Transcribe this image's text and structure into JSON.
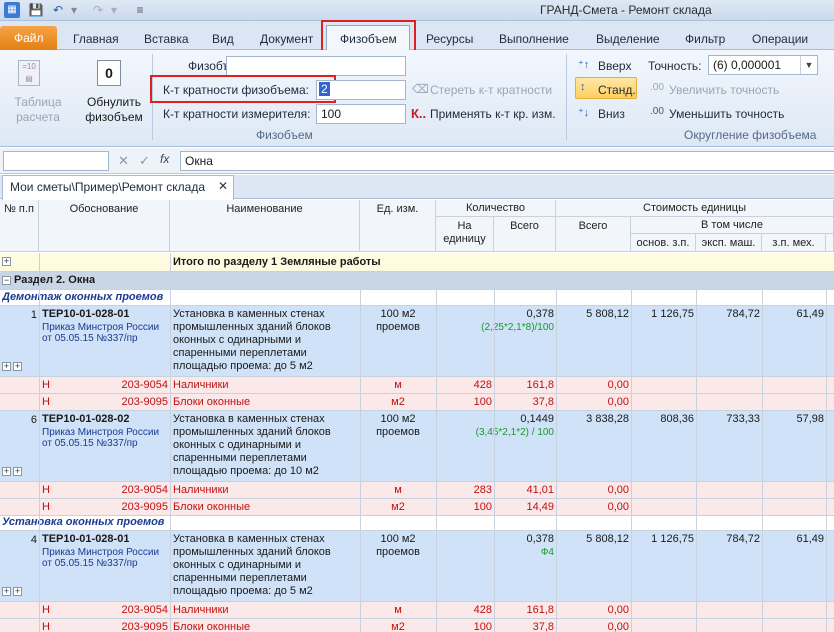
{
  "window": {
    "title": "ГРАНД-Смета - Ремонт склада"
  },
  "ribbon_tabs": [
    "Файл",
    "Главная",
    "Вставка",
    "Вид",
    "Документ",
    "Физобъем",
    "Ресурсы",
    "Выполнение",
    "Выделение",
    "Фильтр",
    "Операции"
  ],
  "ribbon": {
    "table_btn": "Таблица расчета",
    "reset_btn": "Обнулить физобъем",
    "fiz_label": "Физобъем:",
    "fiz_value": "",
    "k_label": "К-т кратности  физобъема:",
    "k_value": "2",
    "km_label": "К-т кратности измерителя:",
    "km_value": "100",
    "clear_k": "Стереть к-т кратности",
    "apply_k": "Применять к-т кр. изм.",
    "apply_k_icon": "К..",
    "group_fiz": "Физобъем",
    "up": "Вверх",
    "std": "Станд.",
    "down": "Вниз",
    "precision_label": "Точность:",
    "precision_value": "(6) 0,000001",
    "inc_prec": "Увеличить точность",
    "dec_prec": "Уменьшить точность",
    "group_round": "Округление физобъема"
  },
  "formula": {
    "value": "Окна"
  },
  "doc_tab": "Мои сметы\\Пример\\Ремонт склада",
  "columns": {
    "n": "№ п.п",
    "basis": "Обоснование",
    "name": "Наименование",
    "unit": "Ед. изм.",
    "qty": "Количество",
    "per_unit": "На единицу",
    "total": "Всего",
    "cost": "Стоимость единицы",
    "cost_total": "Всего",
    "incl": "В том числе",
    "osn": "основ. з.п.",
    "eksp": "эксп. маш.",
    "zpmeh": "з.п. мех."
  },
  "rows": {
    "total1": "Итого по разделу 1 Земляные работы",
    "section2": "Раздел 2. Окна",
    "sub1": "Демонтаж оконных проемов",
    "sub2": "Установка оконных проемов"
  },
  "items": [
    {
      "n": "1",
      "code": "ТЕР10-01-028-01",
      "ref": "Приказ Минстроя России от 05.05.15 №337/пр",
      "name": "Установка в каменных стенах промышленных зданий блоков оконных с одинарными и спаренными переплетами площадью проема: до 5 м2",
      "unit": "100 м2 проемов",
      "qty": "0,378",
      "formula": "(2,25*2,1*8)/100",
      "cost": "5 808,12",
      "osn": "1 126,75",
      "eksp": "784,72",
      "zpmeh": "61,49",
      "res": [
        {
          "t": "Н",
          "code": "203-9054",
          "name": "Наличники",
          "unit": "м",
          "per": "428",
          "total": "161,8",
          "cost": "0,00"
        },
        {
          "t": "Н",
          "code": "203-9095",
          "name": "Блоки оконные",
          "unit": "м2",
          "per": "100",
          "total": "37,8",
          "cost": "0,00"
        }
      ]
    },
    {
      "n": "6",
      "code": "ТЕР10-01-028-02",
      "ref": "Приказ Минстроя России от 05.05.15 №337/пр",
      "name": "Установка в каменных стенах промышленных зданий блоков оконных с одинарными и спаренными переплетами площадью проема: до 10 м2",
      "unit": "100 м2 проемов",
      "qty": "0,1449",
      "formula": "(3,45*2,1*2) / 100",
      "cost": "3 838,28",
      "osn": "808,36",
      "eksp": "733,33",
      "zpmeh": "57,98",
      "res": [
        {
          "t": "Н",
          "code": "203-9054",
          "name": "Наличники",
          "unit": "м",
          "per": "283",
          "total": "41,01",
          "cost": "0,00"
        },
        {
          "t": "Н",
          "code": "203-9095",
          "name": "Блоки оконные",
          "unit": "м2",
          "per": "100",
          "total": "14,49",
          "cost": "0,00"
        }
      ]
    },
    {
      "n": "4",
      "code": "ТЕР10-01-028-01",
      "ref": "Приказ Минстроя России от 05.05.15 №337/пр",
      "name": "Установка в каменных стенах промышленных зданий блоков оконных с одинарными и спаренными переплетами площадью проема: до 5 м2",
      "unit": "100 м2 проемов",
      "qty": "0,378",
      "formula": "Ф4",
      "cost": "5 808,12",
      "osn": "1 126,75",
      "eksp": "784,72",
      "zpmeh": "61,49",
      "res": [
        {
          "t": "Н",
          "code": "203-9054",
          "name": "Наличники",
          "unit": "м",
          "per": "428",
          "total": "161,8",
          "cost": "0,00"
        },
        {
          "t": "Н",
          "code": "203-9095",
          "name": "Блоки оконные",
          "unit": "м2",
          "per": "100",
          "total": "37,8",
          "cost": "0,00"
        }
      ]
    }
  ]
}
